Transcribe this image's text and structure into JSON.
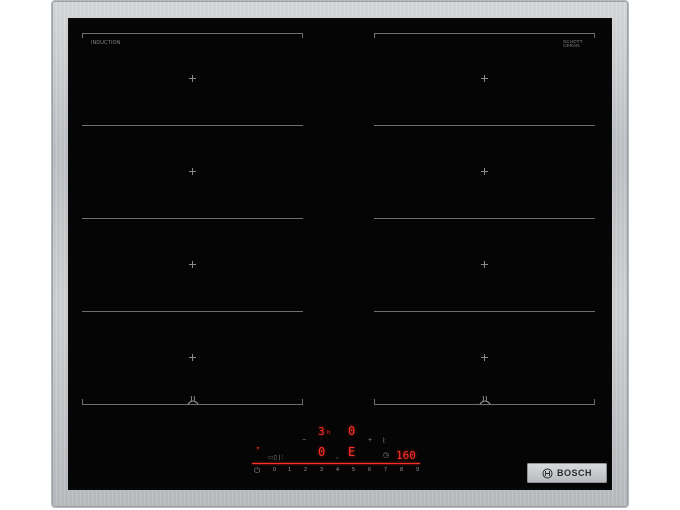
{
  "brand": {
    "logo_text": "BOSCH"
  },
  "panel": {
    "left_label": "INDUCTION",
    "left_sublabel": "",
    "right_label": "SCHOTT\nCERAN",
    "right_sublabel": ""
  },
  "controls": {
    "timer_value": "3",
    "timer_unit": "h",
    "zone_top_value": "0",
    "zone_left_value": "0",
    "zone_mid_value": "E",
    "frying_temp": "160",
    "power_scale": [
      "0",
      "1",
      "2",
      "3",
      "4",
      "5",
      "6",
      "7",
      "8",
      "9"
    ]
  },
  "colors": {
    "glass": "#050505",
    "display_red": "#ff2f27",
    "frame": "#c7c9cc"
  }
}
